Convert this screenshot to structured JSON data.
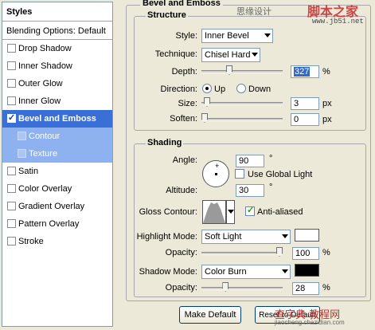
{
  "styles_list": {
    "header": "Styles",
    "blending_options": "Blending Options: Default",
    "items": [
      {
        "label": "Drop Shadow",
        "checked": false
      },
      {
        "label": "Inner Shadow",
        "checked": false
      },
      {
        "label": "Outer Glow",
        "checked": false
      },
      {
        "label": "Inner Glow",
        "checked": false
      },
      {
        "label": "Bevel and Emboss",
        "checked": true,
        "selected": true
      },
      {
        "label": "Contour",
        "checked": false,
        "sub": true
      },
      {
        "label": "Texture",
        "checked": false,
        "sub": true
      },
      {
        "label": "Satin",
        "checked": false
      },
      {
        "label": "Color Overlay",
        "checked": false
      },
      {
        "label": "Gradient Overlay",
        "checked": false
      },
      {
        "label": "Pattern Overlay",
        "checked": false
      },
      {
        "label": "Stroke",
        "checked": false
      }
    ]
  },
  "panel": {
    "title": "Bevel and Emboss",
    "structure": {
      "title": "Structure",
      "style_label": "Style:",
      "style_value": "Inner Bevel",
      "technique_label": "Technique:",
      "technique_value": "Chisel Hard",
      "depth_label": "Depth:",
      "depth_value": "327",
      "depth_unit": "%",
      "depth_fraction": 0.33,
      "direction_label": "Direction:",
      "direction_up": "Up",
      "direction_down": "Down",
      "size_label": "Size:",
      "size_value": "3",
      "size_unit": "px",
      "soften_label": "Soften:",
      "soften_value": "0",
      "soften_unit": "px"
    },
    "shading": {
      "title": "Shading",
      "angle_label": "Angle:",
      "angle_value": "90",
      "angle_unit": "°",
      "global_light_label": "Use Global Light",
      "altitude_label": "Altitude:",
      "altitude_value": "30",
      "altitude_unit": "°",
      "gloss_label": "Gloss Contour:",
      "anti_aliased_label": "Anti-aliased",
      "highlight_mode_label": "Highlight Mode:",
      "highlight_mode_value": "Soft Light",
      "highlight_color": "#ffffff",
      "opacity_label": "Opacity:",
      "highlight_opacity": "100",
      "highlight_opacity_fraction": 1.0,
      "shadow_mode_label": "Shadow Mode:",
      "shadow_mode_value": "Color Burn",
      "shadow_color": "#000000",
      "shadow_opacity": "28",
      "shadow_opacity_fraction": 0.28,
      "percent": "%"
    },
    "buttons": {
      "make_default": "Make Default",
      "reset_default": "Reset to Default"
    }
  },
  "watermarks": {
    "top_gray": "思缘设计",
    "top_red": "脚本之家",
    "top_url": "www.jb51.net",
    "bottom_red": "查字典 教程网",
    "bottom_url": "jiaocheng.chazidian.com"
  }
}
